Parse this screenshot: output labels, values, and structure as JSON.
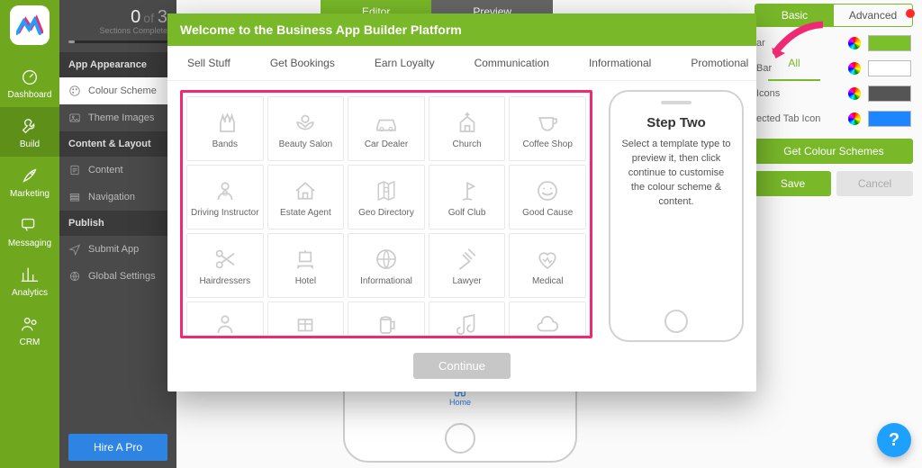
{
  "mainnav": {
    "items": [
      {
        "label": "Dashboard",
        "icon": "gauge"
      },
      {
        "label": "Build",
        "icon": "wrench",
        "active": true
      },
      {
        "label": "Marketing",
        "icon": "rocket"
      },
      {
        "label": "Messaging",
        "icon": "chat"
      },
      {
        "label": "Analytics",
        "icon": "chart"
      },
      {
        "label": "CRM",
        "icon": "people"
      }
    ]
  },
  "progress": {
    "done": "0",
    "total": "3",
    "label": "Sections Complete"
  },
  "secondary": {
    "groups": [
      {
        "title": "App Appearance",
        "items": [
          {
            "label": "Colour Scheme",
            "icon": "palette",
            "active": true
          },
          {
            "label": "Theme Images",
            "icon": "image"
          }
        ]
      },
      {
        "title": "Content & Layout",
        "items": [
          {
            "label": "Content",
            "icon": "doc"
          },
          {
            "label": "Navigation",
            "icon": "nav"
          }
        ]
      },
      {
        "title": "Publish",
        "items": [
          {
            "label": "Submit App",
            "icon": "plane"
          },
          {
            "label": "Global Settings",
            "icon": "globe"
          }
        ]
      }
    ],
    "hire": "Hire A Pro"
  },
  "editor": {
    "tabs": {
      "editor": "Editor",
      "preview": "Preview"
    },
    "phone_home": "Home",
    "settings": {
      "tabs": {
        "basic": "Basic",
        "advanced": "Advanced"
      },
      "rows": [
        {
          "label": "ar",
          "color": "#7cbf2c"
        },
        {
          "label": "Bar",
          "color": "#ffffff"
        },
        {
          "label": "Icons",
          "color": "#555555"
        },
        {
          "label": "ected Tab Icon",
          "color": "#1d86ff"
        }
      ],
      "get_schemes": "Get Colour Schemes",
      "save": "Save",
      "cancel": "Cancel"
    }
  },
  "modal": {
    "title": "Welcome to the Business App Builder Platform",
    "tabs": [
      "Sell Stuff",
      "Get Bookings",
      "Earn Loyalty",
      "Communication",
      "Informational",
      "Promotional",
      "All"
    ],
    "active_tab": "All",
    "templates": [
      {
        "label": "Bands",
        "icon": "rockhand"
      },
      {
        "label": "Beauty Salon",
        "icon": "lotus"
      },
      {
        "label": "Car Dealer",
        "icon": "car"
      },
      {
        "label": "Church",
        "icon": "church"
      },
      {
        "label": "Coffee Shop",
        "icon": "cup"
      },
      {
        "label": "Driving Instructor",
        "icon": "driver"
      },
      {
        "label": "Estate Agent",
        "icon": "house"
      },
      {
        "label": "Geo Directory",
        "icon": "map"
      },
      {
        "label": "Golf Club",
        "icon": "golf"
      },
      {
        "label": "Good Cause",
        "icon": "smile"
      },
      {
        "label": "Hairdressers",
        "icon": "scissors"
      },
      {
        "label": "Hotel",
        "icon": "trolley"
      },
      {
        "label": "Informational",
        "icon": "globe2"
      },
      {
        "label": "Lawyer",
        "icon": "gavel"
      },
      {
        "label": "Medical",
        "icon": "heart"
      }
    ],
    "partial": [
      "person",
      "box",
      "beer",
      "note",
      "cloud"
    ],
    "step": {
      "title": "Step Two",
      "body": "Select a template type to preview it, then click continue to customise the colour scheme & content."
    },
    "continue": "Continue"
  },
  "help": "?"
}
